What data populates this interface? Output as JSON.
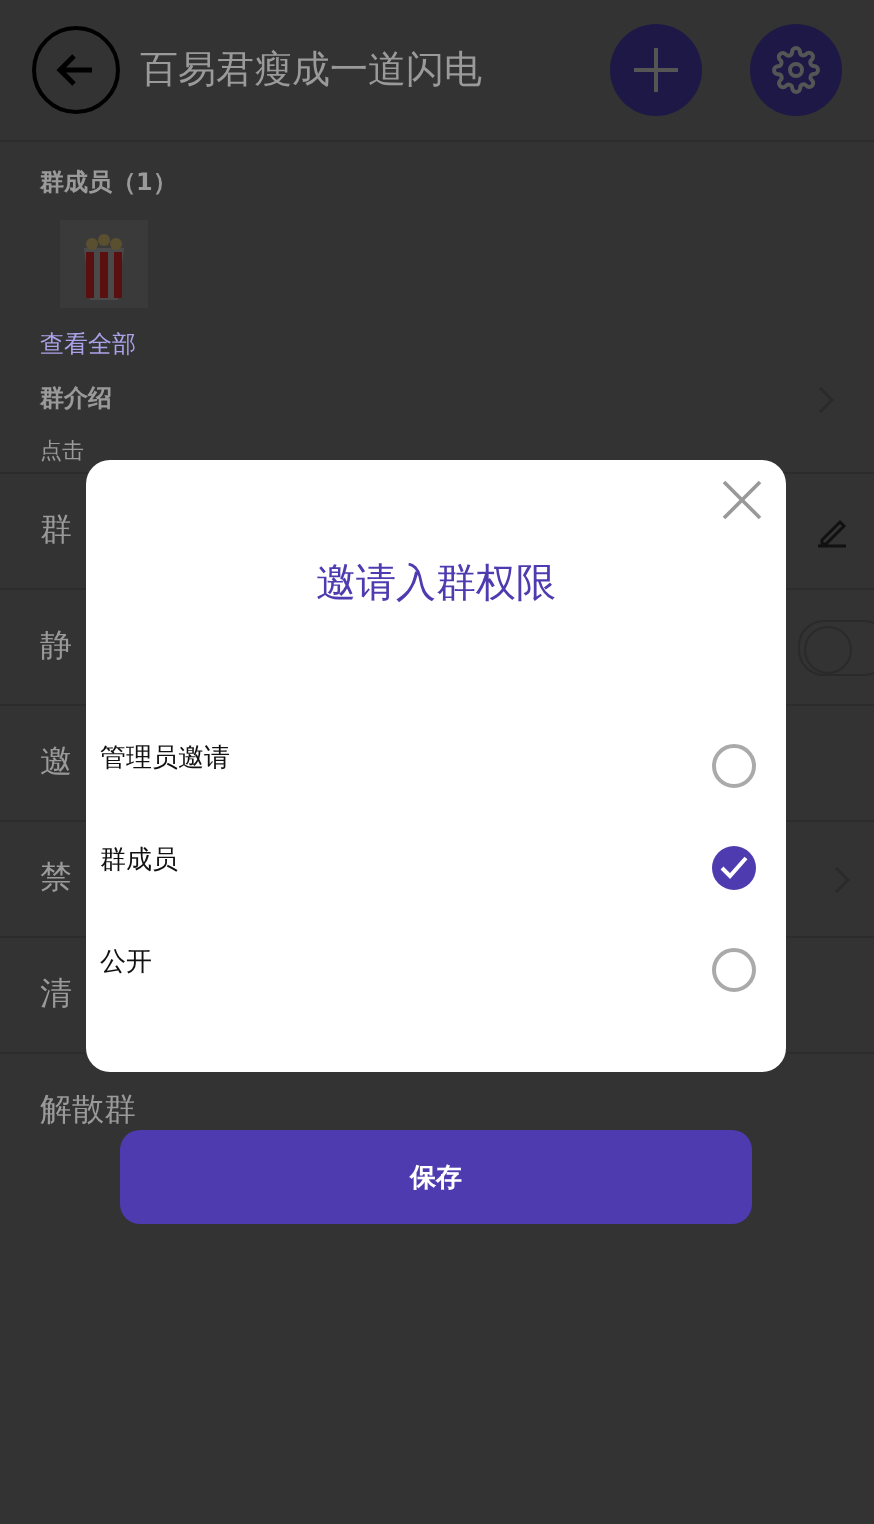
{
  "header": {
    "title": "百易君瘦成一道闪电"
  },
  "members": {
    "label": "群成员（1）",
    "view_all": "查看全部"
  },
  "intro": {
    "label": "群介绍",
    "hint": "点击"
  },
  "rows": [
    {
      "label": "群",
      "kind": "edit"
    },
    {
      "label": "静",
      "kind": "toggle",
      "on": false
    },
    {
      "label": "邀",
      "kind": "plain"
    },
    {
      "label": "禁",
      "kind": "link"
    },
    {
      "label": "清",
      "kind": "plain"
    },
    {
      "label": "解散群",
      "kind": "plain"
    }
  ],
  "dialog": {
    "title": "邀请入群权限",
    "options": [
      {
        "label": "管理员邀请",
        "selected": false
      },
      {
        "label": "群成员",
        "selected": true
      },
      {
        "label": "公开",
        "selected": false
      }
    ]
  },
  "save_button": "保存"
}
